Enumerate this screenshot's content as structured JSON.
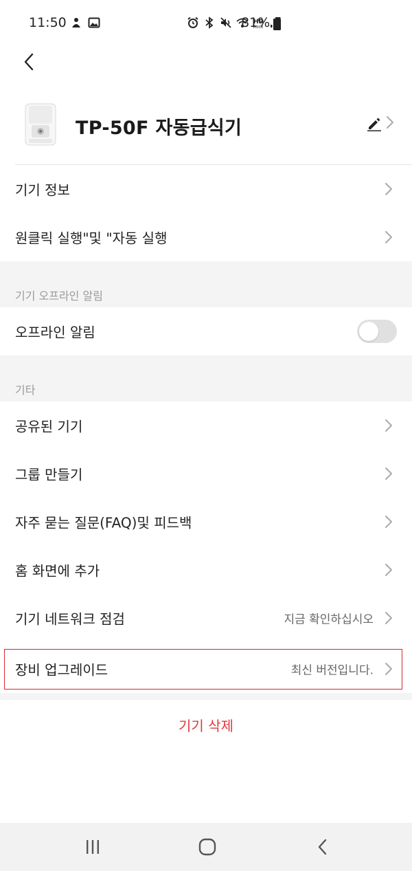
{
  "status_bar": {
    "time": "11:50",
    "battery": "81%"
  },
  "header": {
    "title": "TP-50F 자동급식기",
    "back_icon": "chevron-left-icon",
    "edit_icon": "pencil-icon"
  },
  "rows_top": [
    {
      "label": "기기 정보"
    },
    {
      "label": "원클릭 실행\"및 \"자동 실행"
    }
  ],
  "offline_section": {
    "title": "기기 오프라인 알림",
    "row_label": "오프라인 알림",
    "toggle_on": false
  },
  "other_section": {
    "title": "기타",
    "items": [
      {
        "label": "공유된 기기",
        "value": ""
      },
      {
        "label": "그룹 만들기",
        "value": ""
      },
      {
        "label": "자주 묻는 질문(FAQ)및 피드백",
        "value": ""
      },
      {
        "label": "홈 화면에 추가",
        "value": ""
      },
      {
        "label": "기기 네트워크 점검",
        "value": "지금 확인하십시오"
      },
      {
        "label": "장비 업그레이드",
        "value": "최신 버전입니다."
      }
    ]
  },
  "delete_label": "기기 삭제",
  "colors": {
    "accent_red": "#e2383f",
    "section_bg": "#f4f4f4",
    "highlight": "#d9252c"
  }
}
